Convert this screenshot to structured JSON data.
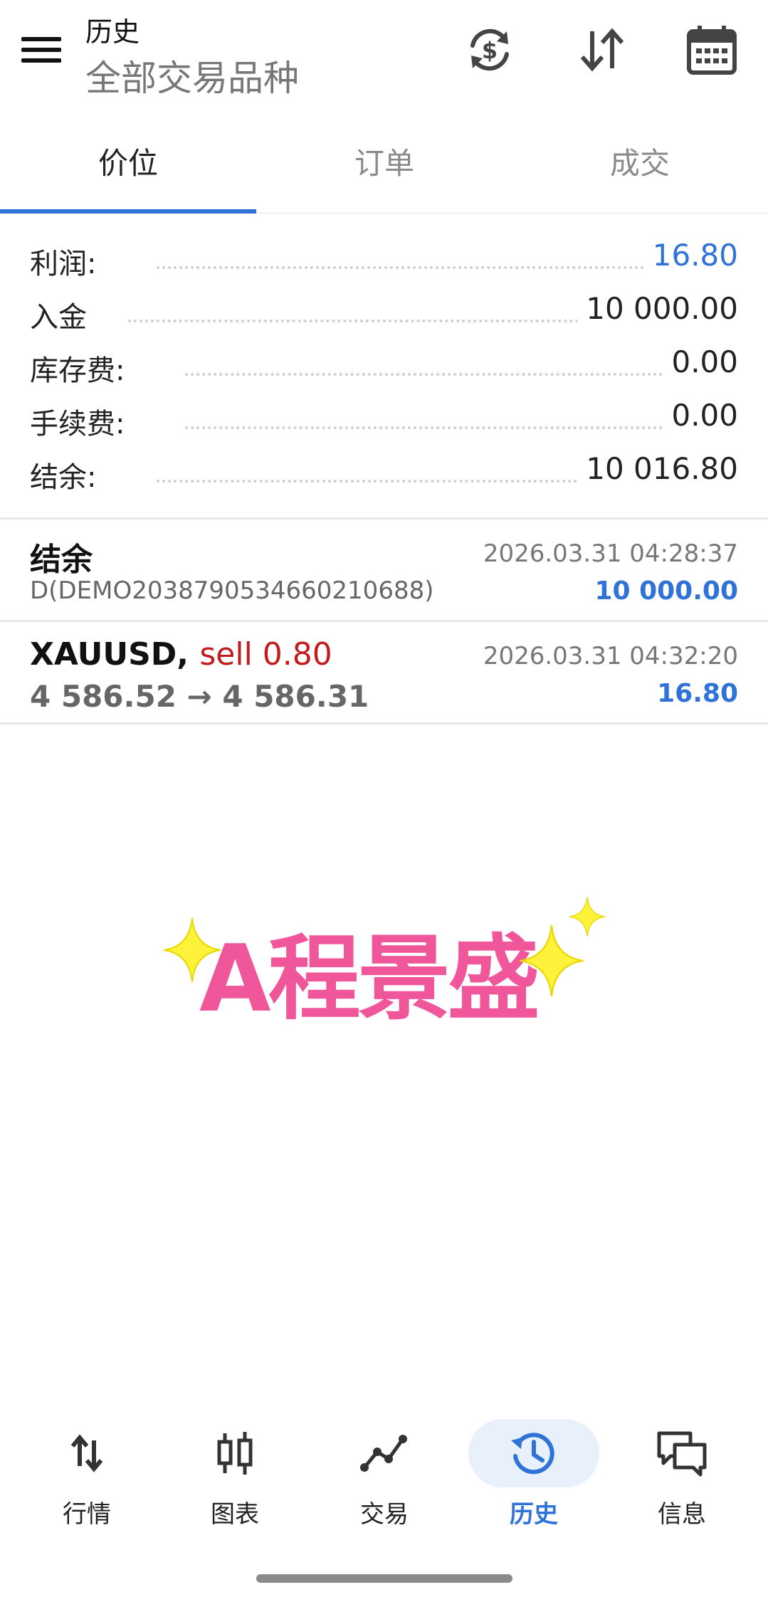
{
  "header": {
    "title": "历史",
    "subtitle": "全部交易品种",
    "icons": [
      "menu-icon",
      "currency-refresh-icon",
      "sort-icon",
      "calendar-icon"
    ]
  },
  "tabs": [
    {
      "label": "价位",
      "active": true
    },
    {
      "label": "订单",
      "active": false
    },
    {
      "label": "成交",
      "active": false
    }
  ],
  "summary": {
    "profit_label": "利润:",
    "profit_value": "16.80",
    "deposit_label": "入金",
    "deposit_value": "10 000.00",
    "swap_label": "库存费:",
    "swap_value": "0.00",
    "commission_label": "手续费:",
    "commission_value": "0.00",
    "balance_label": "结余:",
    "balance_value": "10 016.80"
  },
  "deals": [
    {
      "title": "结余",
      "subtitle": "D(DEMO2038790534660210688)",
      "time": "2026.03.31 04:28:37",
      "amount": "10 000.00"
    },
    {
      "symbol": "XAUUSD,",
      "side": "sell 0.80",
      "prices": "4 586.52 → 4 586.31",
      "time": "2026.03.31 04:32:20",
      "amount": "16.80"
    }
  ],
  "watermark": {
    "text": "A程景盛"
  },
  "bottom_nav": [
    {
      "label": "行情",
      "icon": "quotes-arrows-icon",
      "active": false
    },
    {
      "label": "图表",
      "icon": "candlestick-chart-icon",
      "active": false
    },
    {
      "label": "交易",
      "icon": "trade-line-icon",
      "active": false
    },
    {
      "label": "历史",
      "icon": "history-clock-icon",
      "active": true
    },
    {
      "label": "信息",
      "icon": "chat-bubbles-icon",
      "active": false
    }
  ],
  "colors": {
    "accent": "#2f72d8",
    "sell": "#c21b1b",
    "watermark": "#f0579b",
    "sparkle": "#fff23a"
  }
}
